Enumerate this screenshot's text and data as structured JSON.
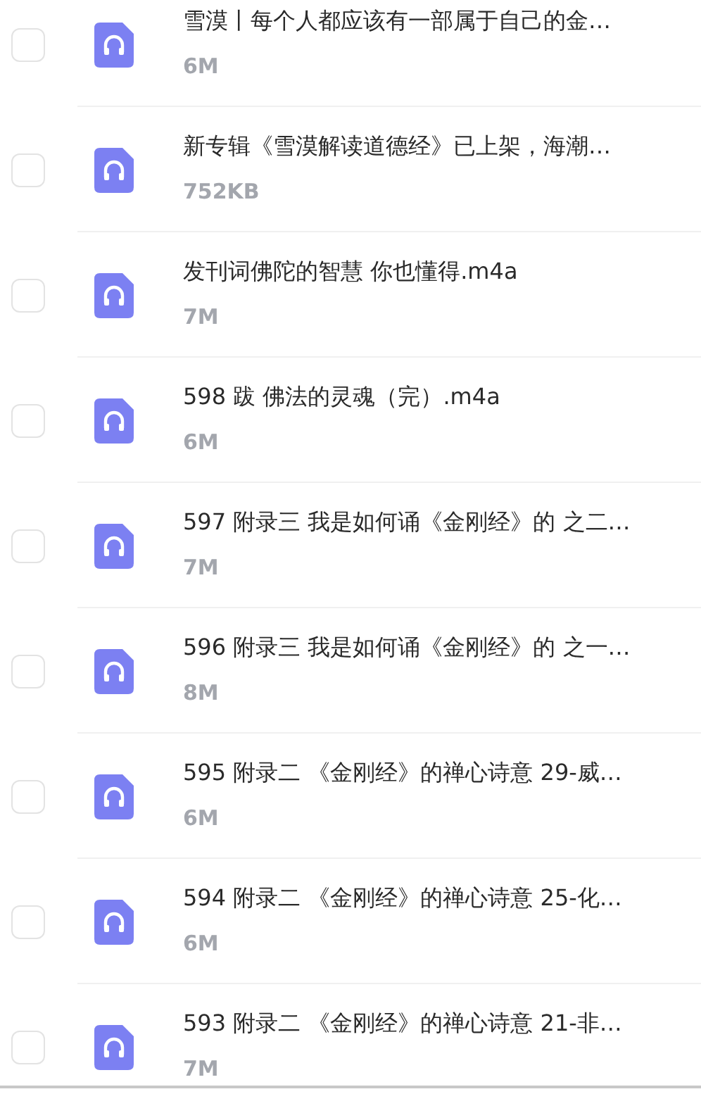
{
  "files": [
    {
      "name": "雪漠丨每个人都应该有一部属于自己的金…",
      "size": "6M",
      "checked": false
    },
    {
      "name": "新专辑《雪漠解读道德经》已上架，海潮…",
      "size": "752KB",
      "checked": false
    },
    {
      "name": "发刊词佛陀的智慧 你也懂得.m4a",
      "size": "7M",
      "checked": false
    },
    {
      "name": "598 跋 佛法的灵魂（完）.m4a",
      "size": "6M",
      "checked": false
    },
    {
      "name": "597 附录三 我是如何诵《金刚经》的 之二…",
      "size": "7M",
      "checked": false
    },
    {
      "name": "596 附录三 我是如何诵《金刚经》的 之一…",
      "size": "8M",
      "checked": false
    },
    {
      "name": "595 附录二 《金刚经》的禅心诗意 29-威…",
      "size": "6M",
      "checked": false
    },
    {
      "name": "594 附录二 《金刚经》的禅心诗意 25-化…",
      "size": "6M",
      "checked": false
    },
    {
      "name": "593 附录二 《金刚经》的禅心诗意 21-非…",
      "size": "7M",
      "checked": false
    }
  ]
}
